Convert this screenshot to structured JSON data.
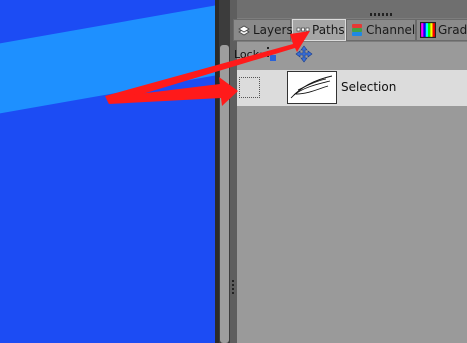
{
  "tabs": [
    {
      "label": "Layers",
      "icon": "layers-icon",
      "active": false
    },
    {
      "label": "Paths",
      "icon": "paths-icon",
      "active": true
    },
    {
      "label": "Channels",
      "icon": "channels-icon",
      "active": false
    },
    {
      "label": "Gradients",
      "icon": "gradients-icon",
      "active": false
    }
  ],
  "toolbar": {
    "lock_label": "Lock:",
    "lock_icon": "lock-icon",
    "move_icon": "move-icon"
  },
  "paths_list": [
    {
      "name": "Selection",
      "visible": false
    }
  ],
  "colors": {
    "canvas": "#1c4cf4",
    "canvas_band": "#1e90ff",
    "annotation_arrow": "#ff1a1a",
    "selected_row": "#dcdcdc"
  }
}
